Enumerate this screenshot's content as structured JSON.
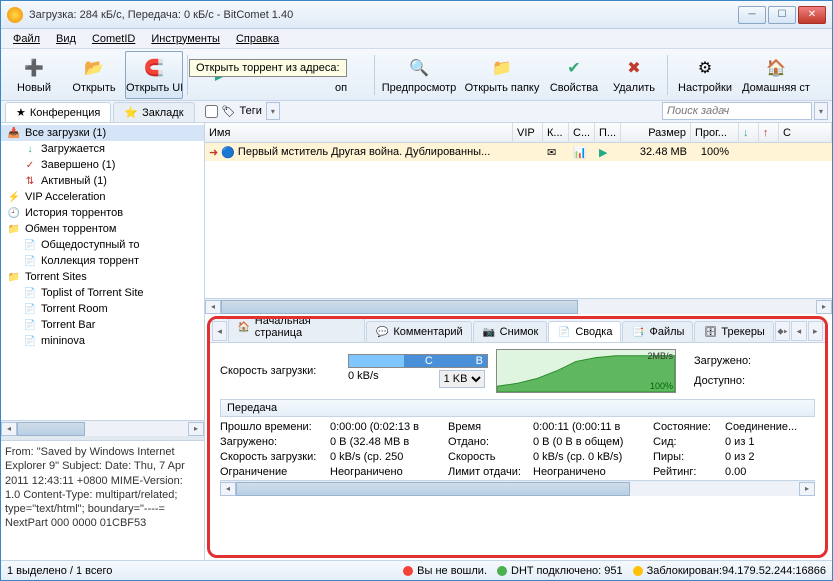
{
  "title": "Загрузка: 284 кБ/с, Передача: 0 кБ/с - BitComet 1.40",
  "menu": [
    "Файл",
    "Вид",
    "CometID",
    "Инструменты",
    "Справка"
  ],
  "toolbar": [
    {
      "label": "Новый",
      "icon": "➕",
      "color": "#2a8"
    },
    {
      "label": "Открыть",
      "icon": "📂",
      "color": "#e8a030"
    },
    {
      "label": "Открыть UR",
      "icon": "🔗",
      "color": "#c0392b"
    },
    {
      "label": "",
      "icon": "",
      "color": ""
    },
    {
      "label": "",
      "icon": "",
      "color": ""
    },
    {
      "label": "",
      "icon": "",
      "color": ""
    },
    {
      "label": "Предпросмотр",
      "icon": "🔍",
      "color": "#3a7"
    },
    {
      "label": "Открыть папку",
      "icon": "📁",
      "color": "#e8a030"
    },
    {
      "label": "Свойства",
      "icon": "✔",
      "color": "#3a7"
    },
    {
      "label": "Удалить",
      "icon": "✖",
      "color": "#c0392b"
    },
    {
      "label": "Настройки",
      "icon": "⚙",
      "color": "#888"
    },
    {
      "label": "Домашняя ст",
      "icon": "🏠",
      "color": "#c0392b"
    }
  ],
  "tooltip": "Открыть торрент из адреса:",
  "tabs": {
    "conference": "Конференция",
    "bookmarks": "Закладк"
  },
  "tags_label": "Теги",
  "search_placeholder": "Поиск задач",
  "tree": [
    {
      "label": "Все загрузки (1)",
      "icon": "📥",
      "sel": true
    },
    {
      "label": "Загружается",
      "icon": "↓",
      "color": "#2a8",
      "child": true
    },
    {
      "label": "Завершено (1)",
      "icon": "✓",
      "color": "#c0392b",
      "child": true
    },
    {
      "label": "Активный (1)",
      "icon": "⇅",
      "color": "#c0392b",
      "child": true
    },
    {
      "label": "VIP Acceleration",
      "icon": "⚡",
      "color": "#e8a030"
    },
    {
      "label": "История торрентов",
      "icon": "🕘",
      "color": "#888"
    },
    {
      "label": "Обмен торрентом",
      "icon": "📁",
      "color": "#e8a030"
    },
    {
      "label": "Общедоступный то",
      "icon": "📄",
      "color": "#3a7",
      "child": true
    },
    {
      "label": "Коллекция торрент",
      "icon": "📄",
      "color": "#3a7",
      "child": true
    },
    {
      "label": "Torrent Sites",
      "icon": "📁",
      "color": "#e8a030"
    },
    {
      "label": "Toplist of Torrent Site",
      "icon": "📄",
      "color": "#3a7",
      "child": true
    },
    {
      "label": "Torrent Room",
      "icon": "📄",
      "color": "#3a7",
      "child": true
    },
    {
      "label": "Torrent Bar",
      "icon": "📄",
      "color": "#3a7",
      "child": true
    },
    {
      "label": "mininova",
      "icon": "📄",
      "color": "#3a7",
      "child": true
    }
  ],
  "info_text": "From: \"Saved by Windows Internet Explorer 9\" Subject: Date: Thu, 7 Apr 2011 12:43:11 +0800 MIME-Version: 1.0 Content-Type: multipart/related; type=\"text/html\"; boundary=\"----= NextPart 000 0000 01CBF53",
  "columns": [
    "Имя",
    "VIP",
    "К...",
    "С...",
    "П...",
    "Размер",
    "Прог...",
    "↓",
    "↑",
    "С"
  ],
  "row": {
    "name": "Первый мститель Другая война. Дублированны...",
    "size": "32.48 MB",
    "progress": "100%"
  },
  "detail_tabs": [
    "Начальная страница",
    "Комментарий",
    "Снимок",
    "Сводка",
    "Файлы",
    "Трекеры"
  ],
  "speed": {
    "label": "Скорость загрузки:",
    "value": "0 kB/s",
    "limit": "1 KB",
    "graph_top": "2MB/s",
    "graph_bot": "100%",
    "downloaded": "Загружено:",
    "available": "Доступно:"
  },
  "transfer_title": "Передача",
  "stats": [
    [
      "Прошло времени:",
      "0:00:00 (0:02:13 в",
      "Время",
      "0:00:11 (0:00:11 в",
      "Состояние:",
      "Соединение..."
    ],
    [
      "Загружено:",
      "0 B (32.48 MB в",
      "Отдано:",
      "0 B (0 B в общем)",
      "Сид:",
      "0 из 1"
    ],
    [
      "Скорость загрузки:",
      "0 kB/s (ср. 250",
      "Скорость",
      "0 kB/s (ср. 0 kB/s)",
      "Пиры:",
      "0 из 2"
    ],
    [
      "Ограничение",
      "Неограничено",
      "Лимит отдачи:",
      "Неограничено",
      "Рейтинг:",
      "0.00"
    ]
  ],
  "status": {
    "selection": "1 выделено / 1 всего",
    "login": "Вы не вошли.",
    "dht": "DHT подключено: 951",
    "blocked": "Заблокирован:94.179.52.244:16866"
  }
}
